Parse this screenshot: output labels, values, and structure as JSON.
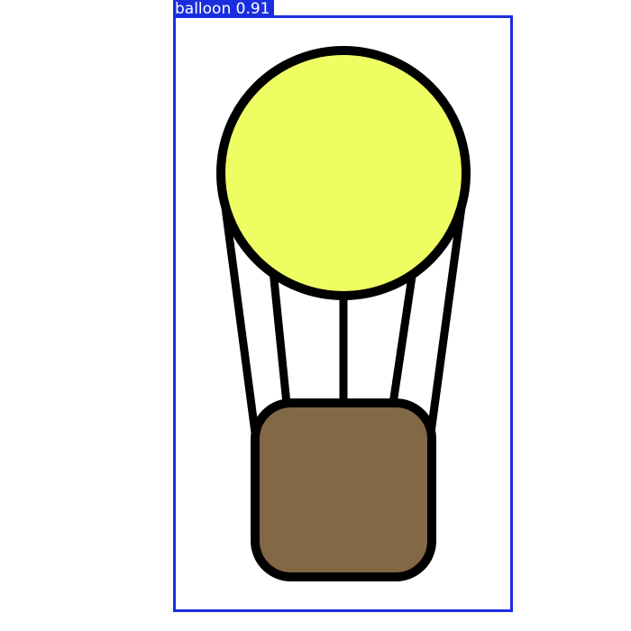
{
  "detection": {
    "label": "balloon 0.91",
    "color": "#1a2ee0"
  },
  "colors": {
    "envelope_fill": "#eefd62",
    "basket_fill": "#826845",
    "outline": "#000000",
    "background": "#ffffff"
  }
}
